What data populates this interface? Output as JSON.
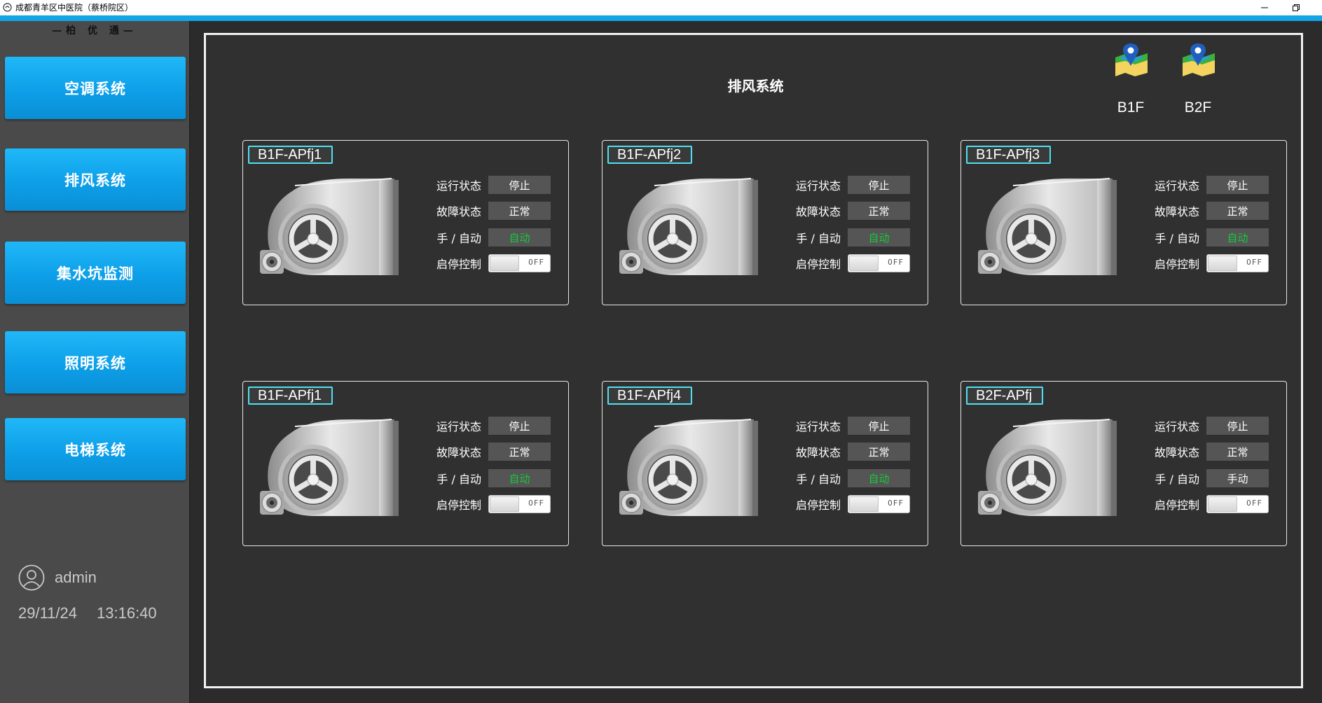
{
  "window": {
    "title": "成都青羊区中医院（蔡桥院区）"
  },
  "sidebar": {
    "brand": "—柏 优 通—",
    "nav": [
      {
        "label": "空调系统",
        "icon": ""
      },
      {
        "label": "排风系统",
        "icon": ""
      },
      {
        "label": "集水坑监测",
        "icon": ""
      },
      {
        "label": "照明系统",
        "icon": ""
      },
      {
        "label": "电梯系统",
        "icon": ""
      }
    ],
    "user": {
      "name": "admin",
      "icon": "user-circle-icon"
    },
    "date": "29/11/24",
    "time": "13:16:40"
  },
  "main": {
    "title": "排风系统",
    "floors": [
      {
        "label": "B1F",
        "icon": "map-pin-icon"
      },
      {
        "label": "B2F",
        "icon": "map-pin-icon"
      }
    ],
    "labels": {
      "run": "运行状态",
      "fault": "故障状态",
      "mode": "手 / 自动",
      "control": "启停控制"
    },
    "devices": [
      {
        "name": "B1F-APfj1",
        "run": "停止",
        "fault": "正常",
        "mode": "自动",
        "mode_auto": true,
        "switch": "OFF"
      },
      {
        "name": "B1F-APfj2",
        "run": "停止",
        "fault": "正常",
        "mode": "自动",
        "mode_auto": true,
        "switch": "OFF"
      },
      {
        "name": "B1F-APfj3",
        "run": "停止",
        "fault": "正常",
        "mode": "自动",
        "mode_auto": true,
        "switch": "OFF"
      },
      {
        "name": "B1F-APfj1",
        "run": "停止",
        "fault": "正常",
        "mode": "自动",
        "mode_auto": true,
        "switch": "OFF"
      },
      {
        "name": "B1F-APfj4",
        "run": "停止",
        "fault": "正常",
        "mode": "自动",
        "mode_auto": true,
        "switch": "OFF"
      },
      {
        "name": "B2F-APfj",
        "run": "停止",
        "fault": "正常",
        "mode": "手动",
        "mode_auto": false,
        "switch": "OFF"
      }
    ],
    "colors": {
      "accent": "#12a6e6",
      "auto_text": "#18c93a",
      "tag_border": "#4fe0f0",
      "nav_button": "#0d9fe8"
    }
  }
}
